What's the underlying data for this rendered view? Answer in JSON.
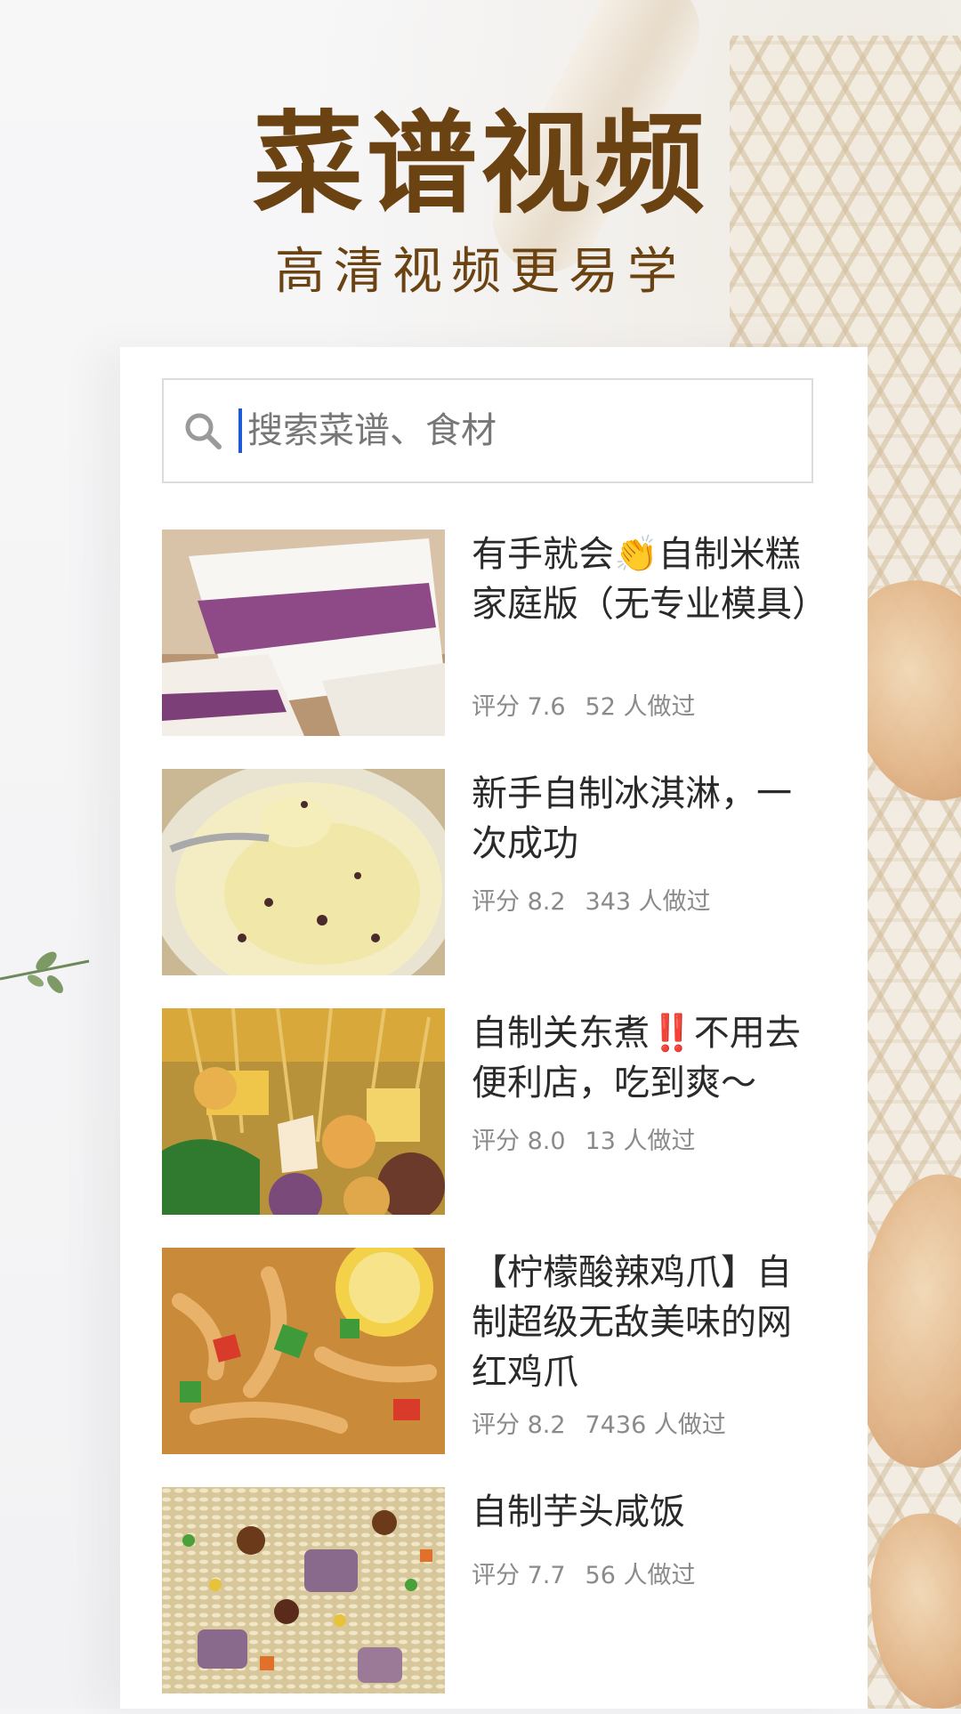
{
  "header": {
    "title": "菜谱视频",
    "subtitle": "高清视频更易学"
  },
  "search": {
    "placeholder": "搜索菜谱、食材",
    "icon": "search-icon"
  },
  "recipes": [
    {
      "title": "有手就会👏自制米糕家庭版（无专业模具）",
      "rating_label": "评分 7.6",
      "made_label": "52 人做过",
      "thumb": "rice-cake-photo"
    },
    {
      "title": "新手自制冰淇淋，一次成功",
      "rating_label": "评分 8.2",
      "made_label": "343 人做过",
      "thumb": "ice-cream-photo"
    },
    {
      "title": "自制关东煮‼️不用去便利店，吃到爽～",
      "rating_label": "评分 8.0",
      "made_label": "13 人做过",
      "thumb": "oden-photo"
    },
    {
      "title": "【柠檬酸辣鸡爪】自制超级无敌美味的网红鸡爪",
      "rating_label": "评分 8.2",
      "made_label": "7436 人做过",
      "thumb": "chicken-feet-photo"
    },
    {
      "title": "自制芋头咸饭",
      "rating_label": "评分 7.7",
      "made_label": "56 人做过",
      "thumb": "taro-rice-photo"
    }
  ],
  "colors": {
    "title_brown": "#6b4212",
    "caret_blue": "#1f5bd8",
    "meta_gray": "#8a8a8a"
  }
}
